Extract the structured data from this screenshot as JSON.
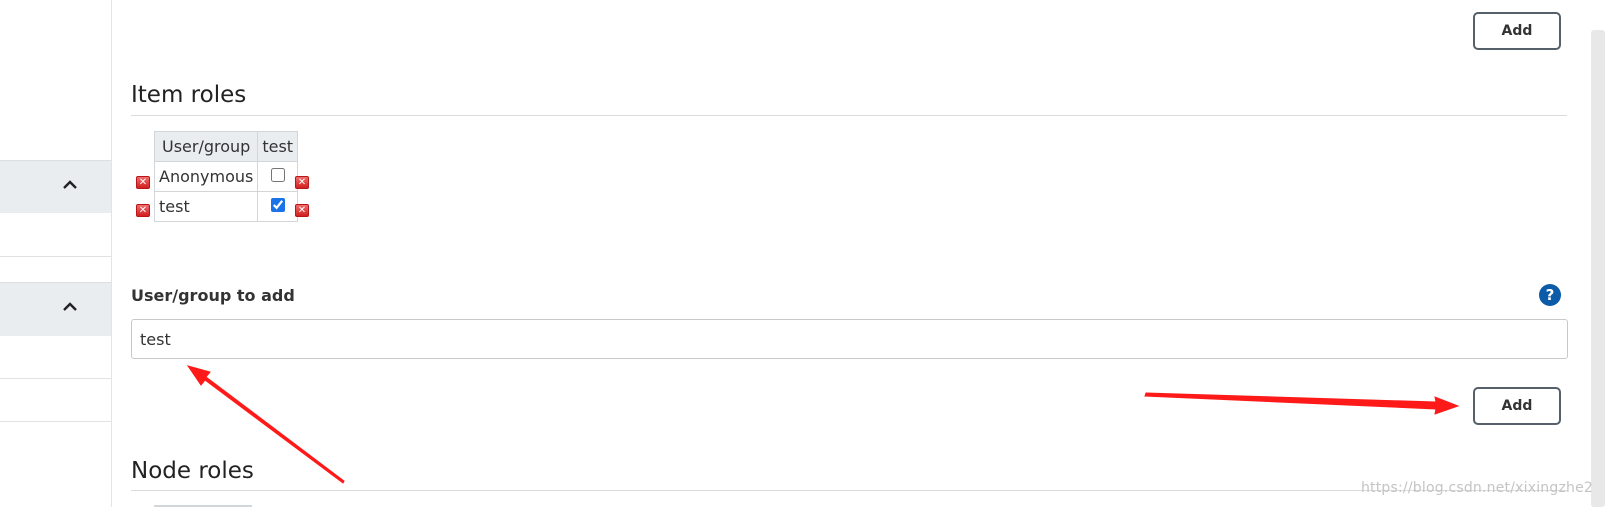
{
  "buttons": {
    "add_top": "Add",
    "add_bottom": "Add"
  },
  "item_roles": {
    "heading": "Item roles",
    "table": {
      "headers": [
        "User/group",
        "test"
      ],
      "rows": [
        {
          "name": "Anonymous",
          "checked": false
        },
        {
          "name": "test",
          "checked": true
        }
      ]
    }
  },
  "add_field": {
    "label": "User/group to add",
    "value": "test",
    "help_symbol": "?"
  },
  "node_roles": {
    "heading": "Node roles"
  },
  "watermark": "https://blog.csdn.net/xixingzhe2",
  "icons": {
    "delete": "delete-x-icon",
    "help": "help-icon",
    "collapse": "chevron-up-icon"
  },
  "colors": {
    "annotation_arrow": "#ff1a1a",
    "help_icon": "#0b5ba8",
    "checkbox": "#1a73e8"
  }
}
